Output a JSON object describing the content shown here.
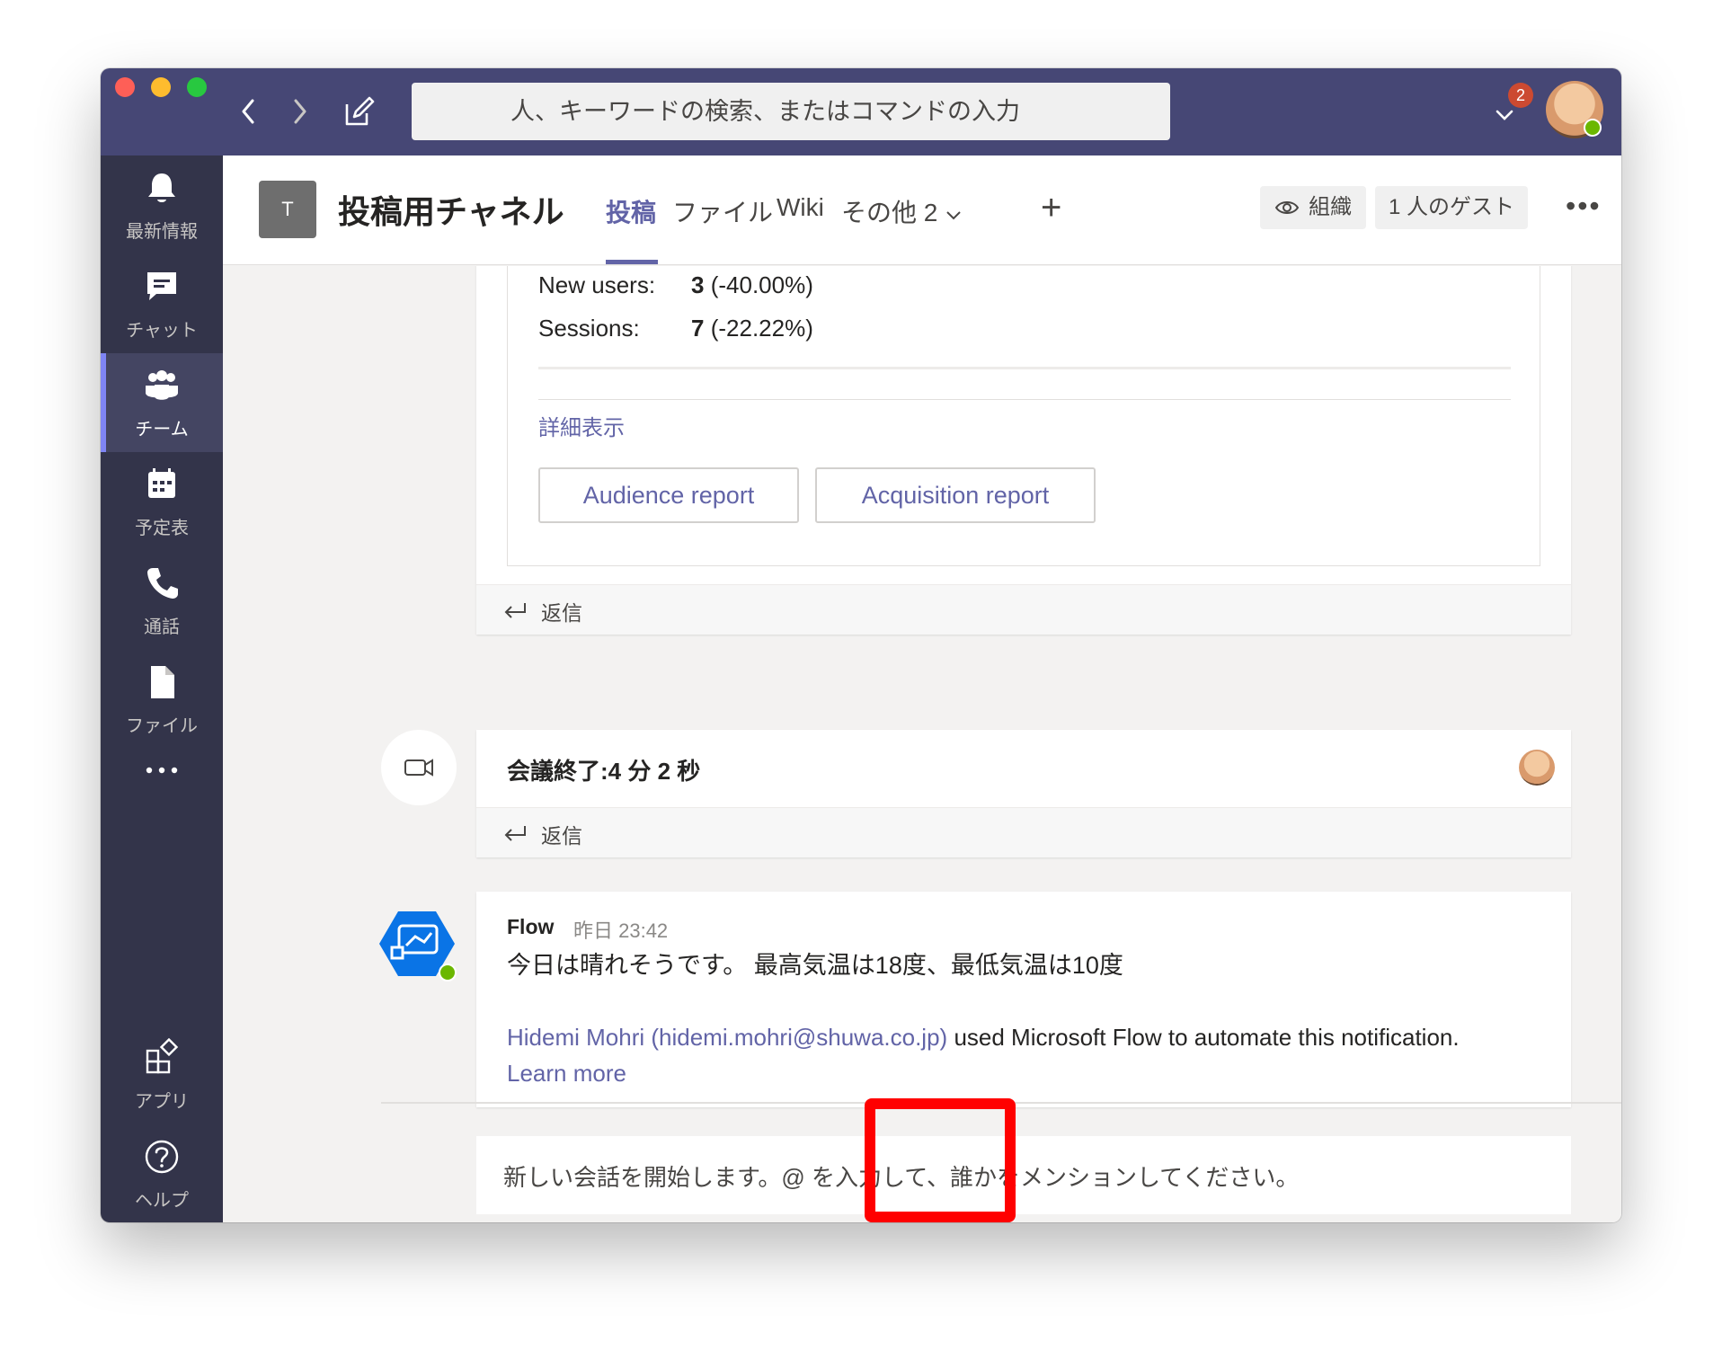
{
  "search": {
    "placeholder": "人、キーワードの検索、またはコマンドの入力"
  },
  "notifications": {
    "count": "2"
  },
  "rail": {
    "items": [
      {
        "label": "最新情報",
        "icon": "bell-icon"
      },
      {
        "label": "チャット",
        "icon": "chat-icon"
      },
      {
        "label": "チーム",
        "icon": "teams-icon",
        "active": true
      },
      {
        "label": "予定表",
        "icon": "calendar-icon"
      },
      {
        "label": "通話",
        "icon": "phone-icon"
      },
      {
        "label": "ファイル",
        "icon": "file-icon"
      }
    ],
    "bottom": [
      {
        "label": "アプリ",
        "icon": "apps-icon"
      },
      {
        "label": "ヘルプ",
        "icon": "help-icon"
      }
    ]
  },
  "channel": {
    "team_initial": "T",
    "title": "投稿用チャネル",
    "tabs": [
      "投稿",
      "ファイル",
      "Wiki",
      "その他 2"
    ],
    "org_label": "組織",
    "guest_label": "1 人のゲスト"
  },
  "card": {
    "rows": [
      {
        "key": "New users:",
        "value": "3",
        "change": "(-40.00%)"
      },
      {
        "key": "Sessions:",
        "value": "7",
        "change": "(-22.22%)"
      }
    ],
    "detail_link": "詳細表示",
    "buttons": [
      "Audience report",
      "Acquisition report"
    ]
  },
  "reply_label": "返信",
  "meeting": {
    "title": "会議終了:4 分 2 秒"
  },
  "flow_post": {
    "sender": "Flow",
    "time": "昨日 23:42",
    "message": "今日は晴れそうです。 最高気温は18度、最低気温は10度",
    "note_link": "Hidemi Mohri (hidemi.mohri@shuwa.co.jp)",
    "note_text": " used Microsoft Flow to automate this notification.",
    "learn_more": "Learn more"
  },
  "compose": {
    "placeholder": "新しい会話を開始します。@ を入力して、誰かをメンションしてください。"
  },
  "colors": {
    "brand": "#6264a7",
    "titlebar": "#464775",
    "rail": "#33344a",
    "highlight": "#ff0000"
  }
}
